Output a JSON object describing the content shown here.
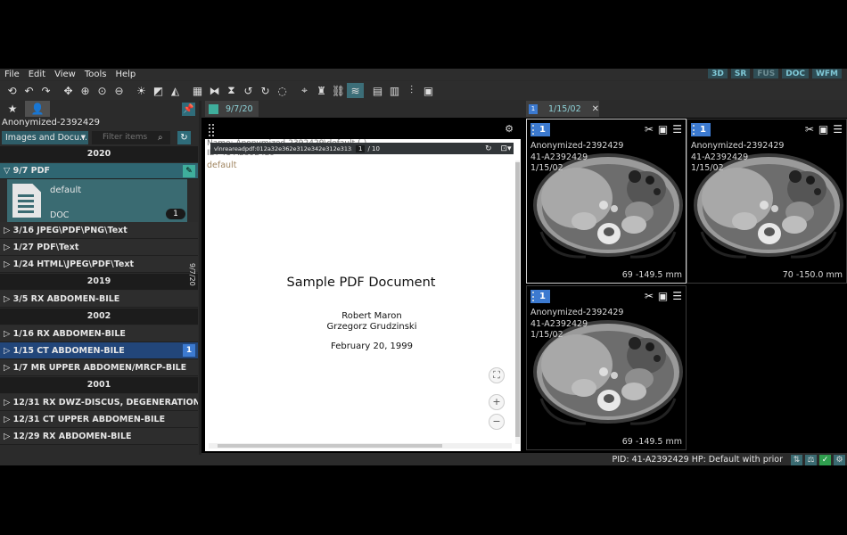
{
  "menu": [
    "File",
    "Edit",
    "View",
    "Tools",
    "Help"
  ],
  "mode_buttons": [
    {
      "label": "3D",
      "dim": false
    },
    {
      "label": "SR",
      "dim": false
    },
    {
      "label": "FUS",
      "dim": true
    },
    {
      "label": "DOC",
      "dim": false
    },
    {
      "label": "WFM",
      "dim": false
    }
  ],
  "left": {
    "patient_name": "Anonymized-2392429",
    "selector_value": "Images and Docu...",
    "filter_placeholder": "Filter items",
    "years": {
      "y2020": "2020",
      "y2019": "2019",
      "y2002": "2002",
      "y2001": "2001"
    },
    "open_study": {
      "label": "9/7   PDF"
    },
    "series": {
      "name": "default",
      "modality": "DOC",
      "count": "1",
      "vertical_date": "9/7/20"
    },
    "studies_2020": [
      "3/16   JPEG\\PDF\\PNG\\Text",
      "1/27   PDF\\Text",
      "1/24   HTML\\JPEG\\PDF\\Text"
    ],
    "studies_2019": [
      "3/5   RX ABDOMEN-BILE"
    ],
    "studies_2002": [
      "1/16   RX ABDOMEN-BILE",
      "1/15   CT ABDOMEN-BILE",
      "1/7   MR UPPER ABDOMEN/MRCP-BILE"
    ],
    "studies_2001": [
      "12/31   RX DWZ-DISCUS, DEGENERATION",
      "12/31   CT UPPER ABDOMEN-BILE",
      "12/29   RX ABDOMEN-BILE"
    ],
    "selected_badge": "1"
  },
  "pdf": {
    "tab_label": "9/7/20",
    "info_name": "Name: Anonymized-2392429\\default (-)",
    "info_id": "ID: 41-A2392429",
    "file_name": "vlnreareadpdf:012a32e362e312e342e312e313...",
    "page_current": "1",
    "page_total": "/ 10",
    "default_label": "default",
    "title": "Sample PDF Document",
    "author1": "Robert Maron",
    "author2": "Grzegorz Grudzinski",
    "date": "February 20, 1999"
  },
  "images": {
    "tab_label": "1/15/02",
    "viewports": [
      {
        "name": "Anonymized-2392429",
        "id": "41-A2392429",
        "date": "1/15/02",
        "slice": "69",
        "position": "-149.5 mm"
      },
      {
        "name": "Anonymized-2392429",
        "id": "41-A2392429",
        "date": "1/15/02",
        "slice": "70",
        "position": "-150.0 mm"
      },
      {
        "name": "Anonymized-2392429",
        "id": "41-A2392429",
        "date": "1/15/02",
        "slice": "69",
        "position": "-149.5 mm"
      }
    ]
  },
  "status": {
    "text": "PID: 41-A2392429  HP: Default with prior"
  },
  "colors": {
    "accent": "#2f6c7a",
    "selected": "#22467a",
    "viewport_badge": "#3c7ad0"
  }
}
